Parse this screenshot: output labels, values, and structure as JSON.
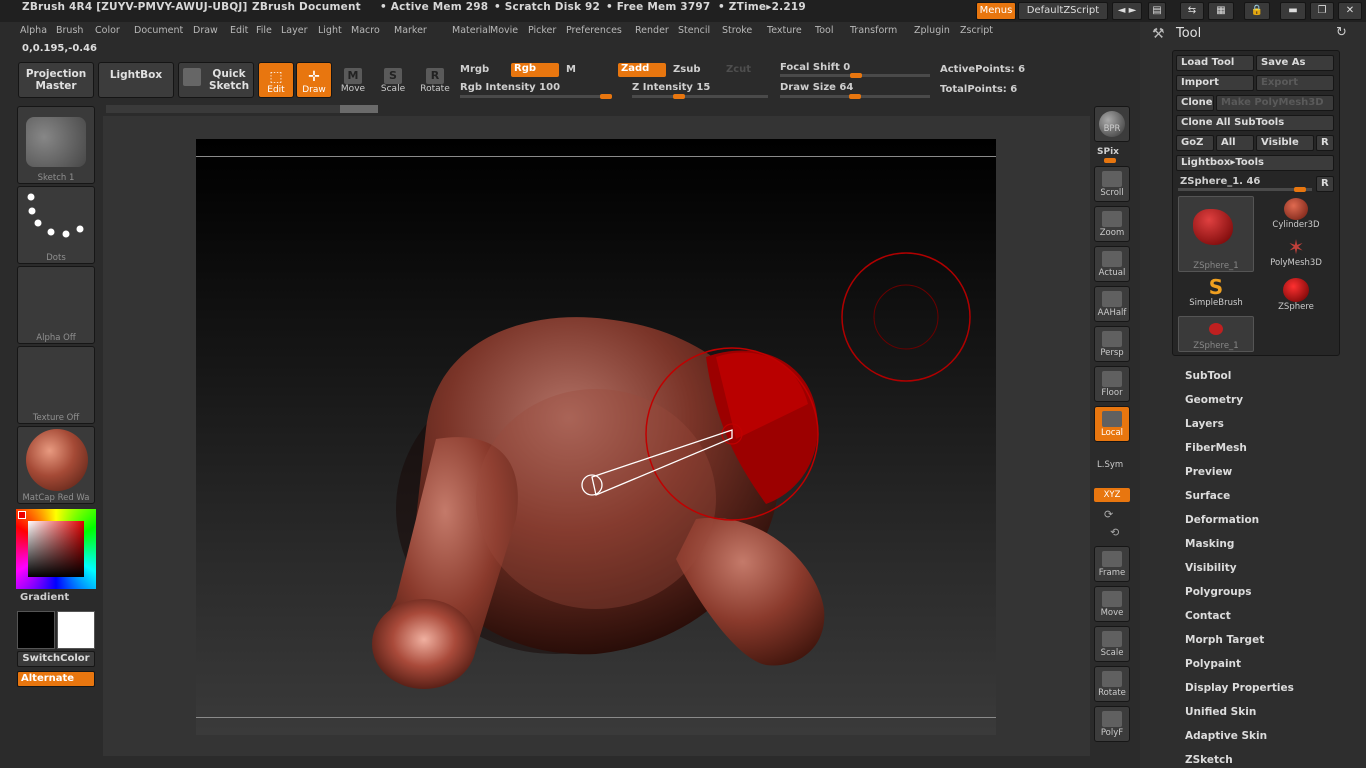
{
  "titlebar": {
    "title": "ZBrush 4R4 [ZUYV-PMVY-AWUJ-UBQJ]",
    "doc": "ZBrush Document",
    "active_mem": "• Active Mem 298",
    "scratch": "• Scratch Disk 92",
    "free_mem": "• Free Mem 3797",
    "ztime": "• ZTime▸2.219",
    "menus_btn": "Menus",
    "zscript_btn": "DefaultZScript"
  },
  "menubar": [
    "Alpha",
    "Brush",
    "Color",
    "Document",
    "Draw",
    "Edit",
    "File",
    "Layer",
    "Light",
    "Macro",
    "Marker",
    "Material",
    "Movie",
    "Picker",
    "Preferences",
    "Render",
    "Stencil",
    "Stroke",
    "Texture",
    "Tool",
    "Transform",
    "Zplugin",
    "Zscript"
  ],
  "coords": "0,0.195,-0.46",
  "toolbar": {
    "projection_master": "Projection Master",
    "lightbox": "LightBox",
    "quick_sketch": "Quick Sketch",
    "edit": "Edit",
    "draw": "Draw",
    "move": "Move",
    "scale": "Scale",
    "rotate": "Rotate",
    "mrgb": "Mrgb",
    "rgb": "Rgb",
    "m": "M",
    "zadd": "Zadd",
    "zsub": "Zsub",
    "zcut": "Zcut",
    "rgb_intensity": "Rgb Intensity 100",
    "z_intensity": "Z Intensity 15",
    "focal_shift": "Focal Shift 0",
    "draw_size": "Draw Size 64",
    "active_points": "ActivePoints: 6",
    "total_points": "TotalPoints: 6",
    "rgb_intensity_value": 100,
    "z_intensity_value": 15,
    "focal_shift_value": 0,
    "draw_size_value": 64
  },
  "left": {
    "sketch": "Sketch 1",
    "dots": "Dots",
    "alpha": "Alpha Off",
    "texture": "Texture Off",
    "matcap": "MatCap Red Wa",
    "gradient": "Gradient",
    "switchcolor": "SwitchColor",
    "alternate": "Alternate"
  },
  "shelf": [
    "BPR",
    "SPix",
    "Scroll",
    "Zoom",
    "Actual",
    "AAHalf",
    "Persp",
    "Floor",
    "Local",
    "L.Sym",
    "XYZ",
    "Frame",
    "Move",
    "Scale",
    "Rotate",
    "PolyF"
  ],
  "tool": {
    "title": "Tool",
    "load_tool": "Load Tool",
    "save_as": "Save As",
    "import": "Import",
    "export": "Export",
    "clone": "Clone",
    "make_polymesh": "Make PolyMesh3D",
    "clone_all": "Clone All SubTools",
    "goz": "GoZ",
    "all": "All",
    "visible": "Visible",
    "r": "R",
    "lightbox_tools": "Lightbox▸Tools",
    "current": "ZSphere_1. 46",
    "thumbs": [
      "ZSphere_1",
      "Cylinder3D",
      "PolyMesh3D",
      "SimpleBrush",
      "ZSphere",
      "ZSphere_1"
    ],
    "menu": [
      "SubTool",
      "Geometry",
      "Layers",
      "FiberMesh",
      "Preview",
      "Surface",
      "Deformation",
      "Masking",
      "Visibility",
      "Polygroups",
      "Contact",
      "Morph Target",
      "Polypaint",
      "Display Properties",
      "Unified Skin",
      "Adaptive Skin",
      "ZSketch"
    ]
  },
  "colors": {
    "accent": "#e8760f",
    "model": "#8a3a2c"
  }
}
